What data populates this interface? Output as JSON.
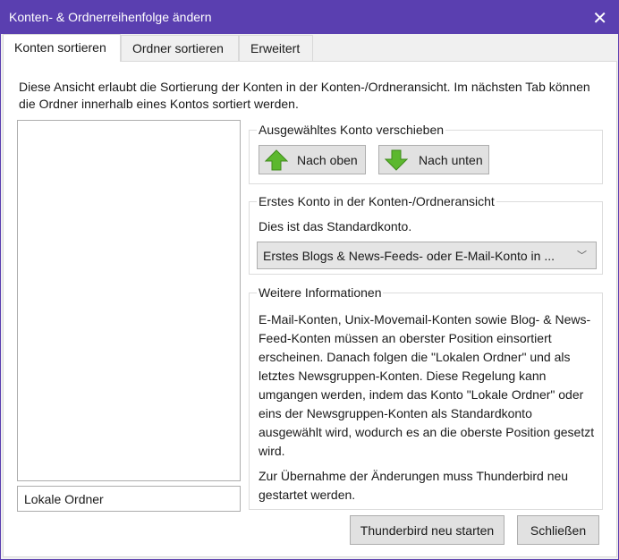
{
  "window": {
    "title": "Konten- & Ordnerreihenfolge ändern",
    "close": "✕"
  },
  "tabs": [
    {
      "label": "Konten sortieren"
    },
    {
      "label": "Ordner sortieren"
    },
    {
      "label": "Erweitert"
    }
  ],
  "description": "Diese Ansicht erlaubt die Sortierung der Konten in der Konten-/Ordneransicht. Im nächsten Tab können die Ordner innerhalb eines Kontos sortiert werden.",
  "selected_account": "Lokale Ordner",
  "move_group": {
    "legend": "Ausgewähltes Konto verschieben",
    "up_label": "Nach oben",
    "down_label": "Nach unten"
  },
  "first_group": {
    "legend": "Erstes Konto in der Konten-/Ordneransicht",
    "status": "Dies ist das Standardkonto.",
    "select_value": "Erstes Blogs & News-Feeds- oder E-Mail-Konto in ..."
  },
  "info_group": {
    "legend": "Weitere Informationen",
    "text1": "E-Mail-Konten, Unix-Movemail-Konten sowie Blog- & News-Feed-Konten müssen an oberster Position einsortiert erscheinen. Danach folgen die \"Lokalen Ordner\" und als letztes Newsgruppen-Konten. Diese Regelung kann umgangen werden, indem das Konto \"Lokale Ordner\" oder eins der Newsgruppen-Konten als Standardkonto ausgewählt wird, wodurch es an die oberste Position gesetzt wird.",
    "text2": "Zur Übernahme der Änderungen muss Thunderbird neu gestartet werden."
  },
  "buttons": {
    "restart": "Thunderbird neu starten",
    "close": "Schließen"
  },
  "colors": {
    "titlebar": "#5a3fb0",
    "arrow": "#5cb82e"
  }
}
